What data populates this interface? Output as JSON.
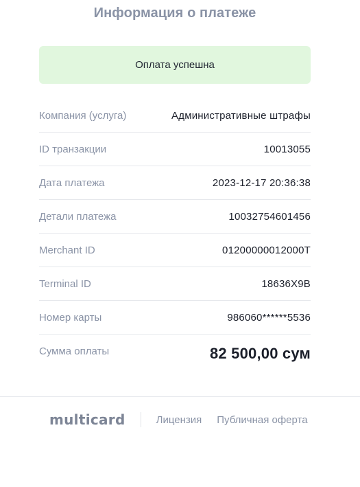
{
  "header": {
    "title": "Информация о платеже"
  },
  "status": {
    "text": "Оплата успешна",
    "color": "#e1f7de"
  },
  "details": {
    "rows": [
      {
        "label": "Компания (услуга)",
        "value": "Административные штрафы"
      },
      {
        "label": "ID транзакции",
        "value": "10013055"
      },
      {
        "label": "Дата платежа",
        "value": "2023-12-17 20:36:38"
      },
      {
        "label": "Детали платежа",
        "value": "10032754601456"
      },
      {
        "label": "Merchant ID",
        "value": "01200000012000T"
      },
      {
        "label": "Terminal ID",
        "value": "18636X9B"
      },
      {
        "label": "Номер карты",
        "value": "986060******5536"
      }
    ],
    "total": {
      "label": "Сумма оплаты",
      "value": "82 500,00 сум"
    }
  },
  "footer": {
    "brand": "multicard",
    "links": [
      "Лицензия",
      "Публичная оферта"
    ]
  }
}
